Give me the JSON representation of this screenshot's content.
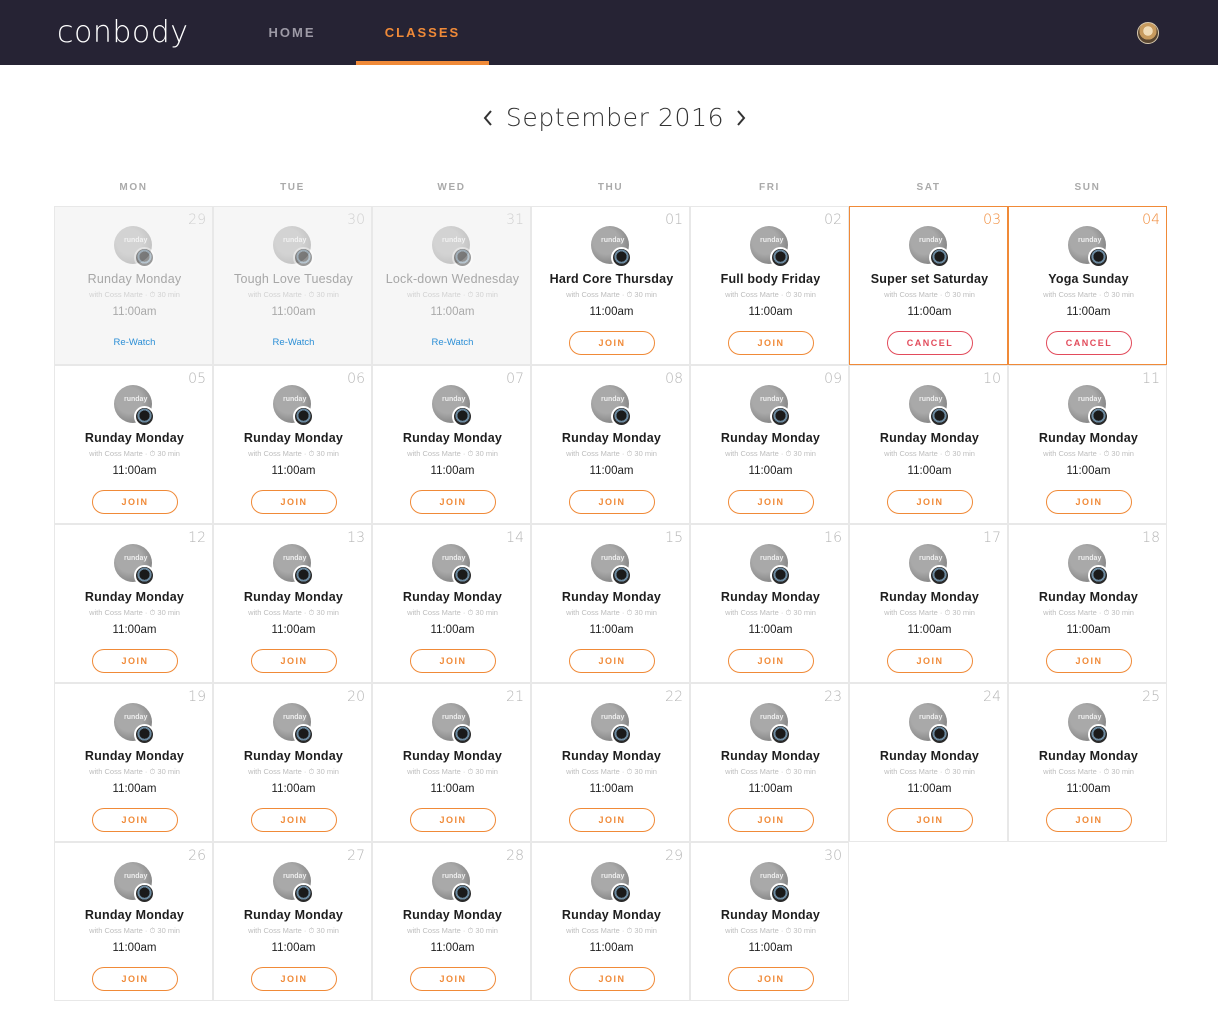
{
  "brand": {
    "logo": "conbody"
  },
  "nav": {
    "home": "HOME",
    "classes": "CLASSES"
  },
  "calendar": {
    "month_title": "September 2016",
    "weekdays": [
      "MON",
      "TUE",
      "WED",
      "THU",
      "FRI",
      "SAT",
      "SUN"
    ],
    "subtitle": "with Coss Marte · ⏱ 30 min",
    "time": "11:00am",
    "join_label": "JOIN",
    "cancel_label": "CANCEL",
    "rewatch_label": "Re-Watch",
    "days": [
      {
        "num": "29",
        "title": "Runday Monday",
        "state": "past"
      },
      {
        "num": "30",
        "title": "Tough Love Tuesday",
        "state": "past"
      },
      {
        "num": "31",
        "title": "Lock-down Wednesday",
        "state": "past"
      },
      {
        "num": "01",
        "title": "Hard Core Thursday",
        "state": "join"
      },
      {
        "num": "02",
        "title": "Full body Friday",
        "state": "join"
      },
      {
        "num": "03",
        "title": "Super set Saturday",
        "state": "booked"
      },
      {
        "num": "04",
        "title": "Yoga Sunday",
        "state": "booked"
      },
      {
        "num": "05",
        "title": "Runday Monday",
        "state": "join"
      },
      {
        "num": "06",
        "title": "Runday Monday",
        "state": "join"
      },
      {
        "num": "07",
        "title": "Runday Monday",
        "state": "join"
      },
      {
        "num": "08",
        "title": "Runday Monday",
        "state": "join"
      },
      {
        "num": "09",
        "title": "Runday Monday",
        "state": "join"
      },
      {
        "num": "10",
        "title": "Runday Monday",
        "state": "join"
      },
      {
        "num": "11",
        "title": "Runday Monday",
        "state": "join"
      },
      {
        "num": "12",
        "title": "Runday Monday",
        "state": "join"
      },
      {
        "num": "13",
        "title": "Runday Monday",
        "state": "join"
      },
      {
        "num": "14",
        "title": "Runday Monday",
        "state": "join"
      },
      {
        "num": "15",
        "title": "Runday Monday",
        "state": "join"
      },
      {
        "num": "16",
        "title": "Runday Monday",
        "state": "join"
      },
      {
        "num": "17",
        "title": "Runday Monday",
        "state": "join"
      },
      {
        "num": "18",
        "title": "Runday Monday",
        "state": "join"
      },
      {
        "num": "19",
        "title": "Runday Monday",
        "state": "join"
      },
      {
        "num": "20",
        "title": "Runday Monday",
        "state": "join"
      },
      {
        "num": "21",
        "title": "Runday Monday",
        "state": "join"
      },
      {
        "num": "22",
        "title": "Runday Monday",
        "state": "join"
      },
      {
        "num": "23",
        "title": "Runday Monday",
        "state": "join"
      },
      {
        "num": "24",
        "title": "Runday Monday",
        "state": "join"
      },
      {
        "num": "25",
        "title": "Runday Monday",
        "state": "join"
      },
      {
        "num": "26",
        "title": "Runday Monday",
        "state": "join"
      },
      {
        "num": "27",
        "title": "Runday Monday",
        "state": "join"
      },
      {
        "num": "28",
        "title": "Runday Monday",
        "state": "join"
      },
      {
        "num": "29",
        "title": "Runday Monday",
        "state": "join"
      },
      {
        "num": "30",
        "title": "Runday Monday",
        "state": "join"
      }
    ]
  },
  "colors": {
    "accent": "#f08a38",
    "cancel": "#e24b5b",
    "link": "#2c8fd6",
    "topbar": "#262334"
  }
}
